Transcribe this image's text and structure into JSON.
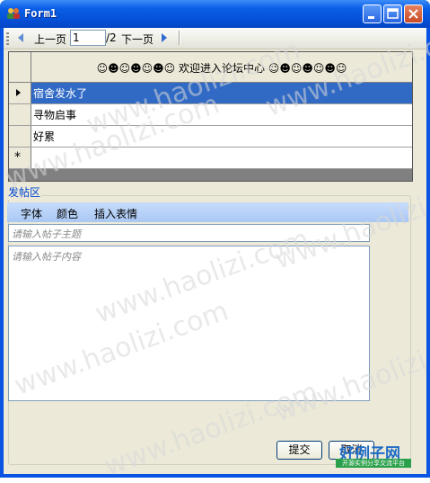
{
  "window": {
    "title": "Form1"
  },
  "toolbar": {
    "prev_label": "上一页",
    "page_value": "1",
    "page_total": "/2",
    "next_label": "下一页"
  },
  "grid": {
    "header": "☺☻☺☻☺☻☺ 欢迎进入论坛中心 ☺☻☺☻☺☻☺",
    "rows": [
      "宿舍发水了",
      "寻物启事",
      "好累"
    ],
    "new_row_marker": "*"
  },
  "post_area": {
    "title": "发帖区",
    "menu": [
      "字体",
      "颜色",
      "插入表情"
    ],
    "subject_placeholder": "请输入帖子主题",
    "content_placeholder": "请输入帖子内容",
    "submit_label": "提交",
    "cancel_label": "取消"
  },
  "watermark": "www.haolizi.com",
  "logo": {
    "main": "好例子网",
    "sub": "开源实例分享交流平台"
  },
  "colors": {
    "title_bar": "#0a54e4",
    "selection": "#316ac5",
    "menubar": "#c6dcfb",
    "group_title": "#0046d5"
  }
}
